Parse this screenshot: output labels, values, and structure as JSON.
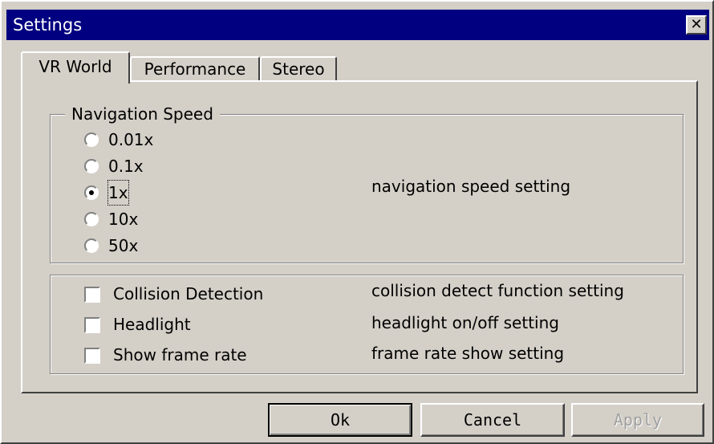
{
  "window": {
    "title": "Settings",
    "close_glyph": "✕"
  },
  "tabs": [
    {
      "label": "VR World",
      "active": true
    },
    {
      "label": "Performance",
      "active": false
    },
    {
      "label": "Stereo",
      "active": false
    }
  ],
  "navigation": {
    "legend": "Navigation Speed",
    "options": [
      "0.01x",
      "0.1x",
      "1x",
      "10x",
      "50x"
    ],
    "selected": "1x",
    "description": "navigation speed setting"
  },
  "options": [
    {
      "label": "Collision Detection",
      "checked": false,
      "description": "collision detect function setting"
    },
    {
      "label": "Headlight",
      "checked": false,
      "description": "headlight on/off setting"
    },
    {
      "label": "Show frame rate",
      "checked": false,
      "description": "frame rate show setting"
    }
  ],
  "buttons": {
    "ok": "Ok",
    "cancel": "Cancel",
    "apply": "Apply",
    "apply_disabled": true
  },
  "colors": {
    "titlebar": "#000080",
    "face": "#d4d0c8"
  }
}
